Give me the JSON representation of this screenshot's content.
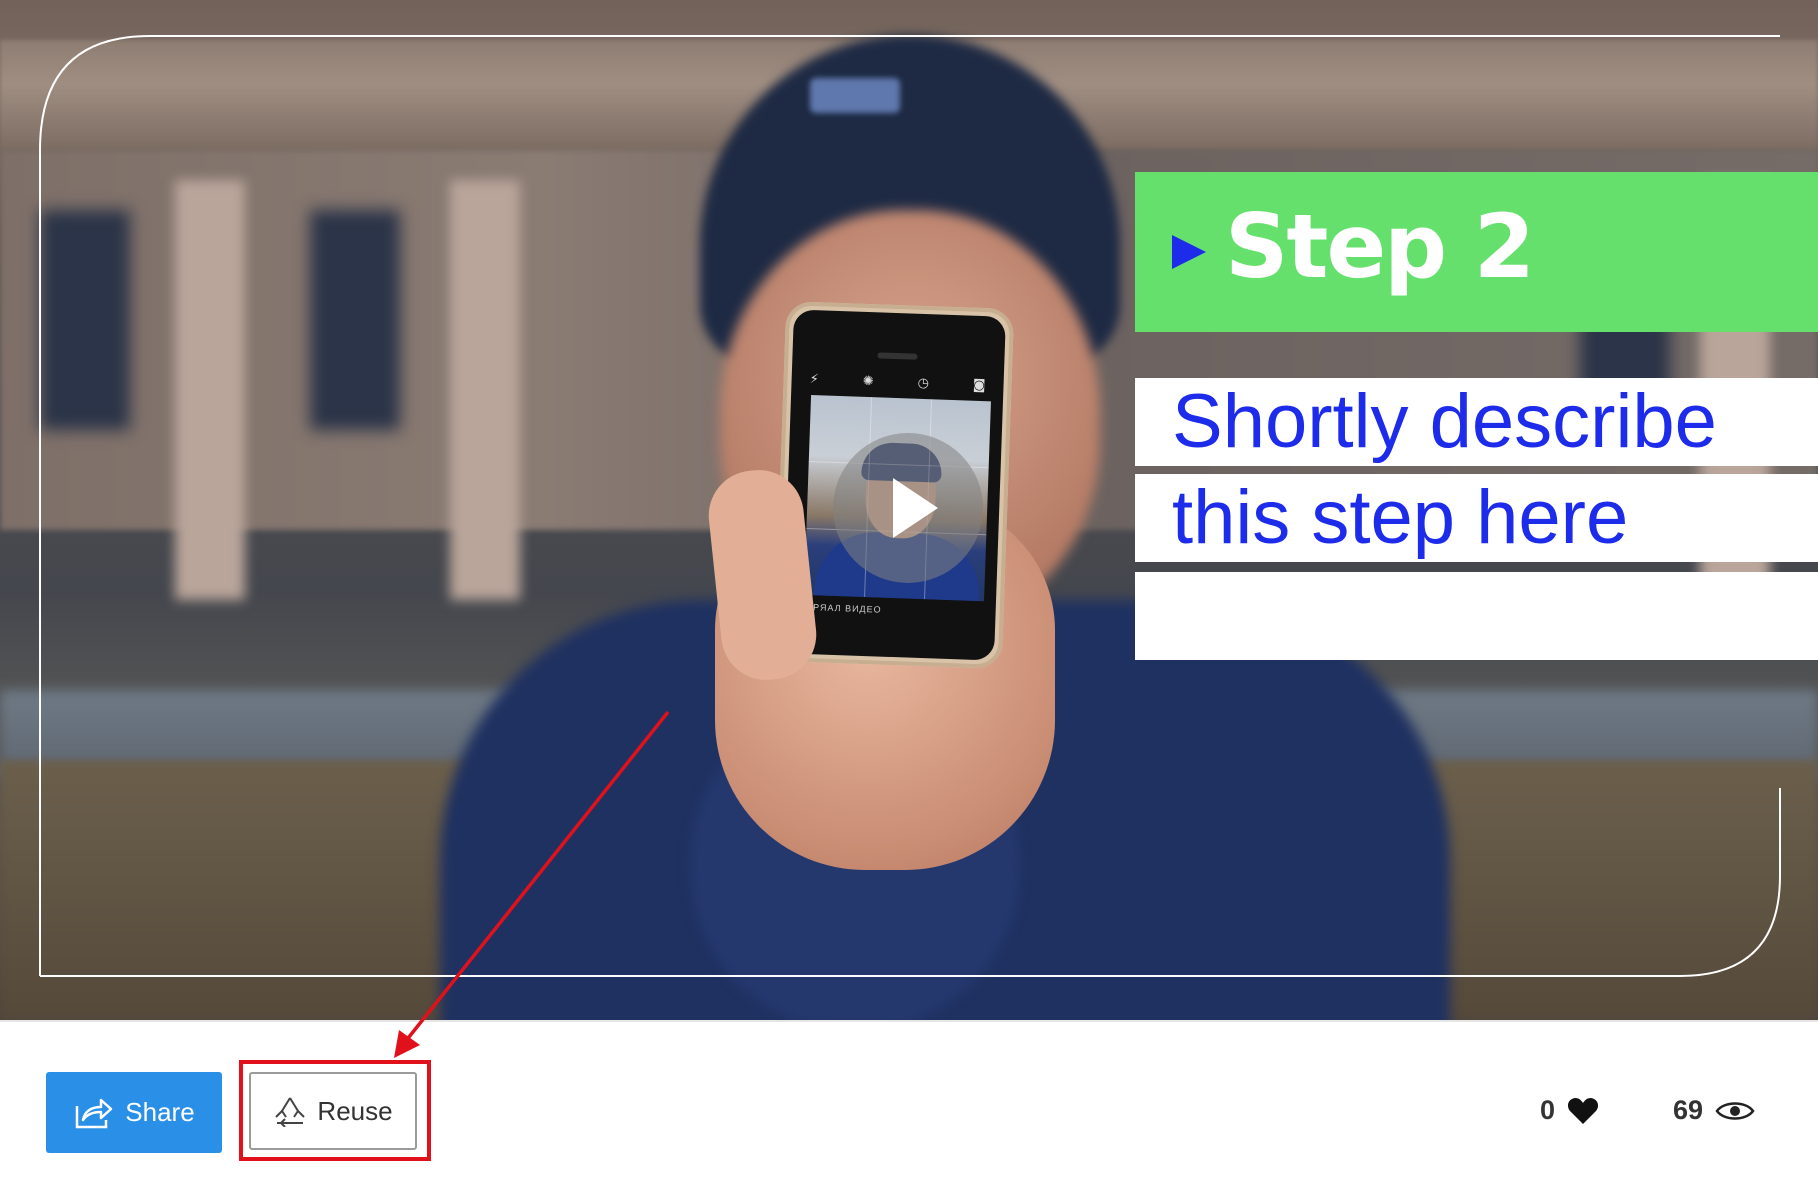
{
  "video": {
    "step_title": "Step 2",
    "description_lines": [
      "Shortly describe",
      "this step here"
    ],
    "play_icon": "play-icon",
    "phone_mode_labels": "ПРЯАЛ   ВИДЕО"
  },
  "toolbar": {
    "share_label": "Share",
    "share_icon": "share-arrow-icon",
    "reuse_label": "Reuse",
    "reuse_icon": "recycle-icon"
  },
  "stats": {
    "likes": "0",
    "likes_icon": "heart-icon",
    "views": "69",
    "views_icon": "eye-icon"
  },
  "annotation": {
    "color": "#e0111b",
    "highlighted": "Reuse"
  },
  "colors": {
    "step_band": "#66e06c",
    "description_text": "#1d2bea",
    "share_button": "#2a8fe6"
  }
}
